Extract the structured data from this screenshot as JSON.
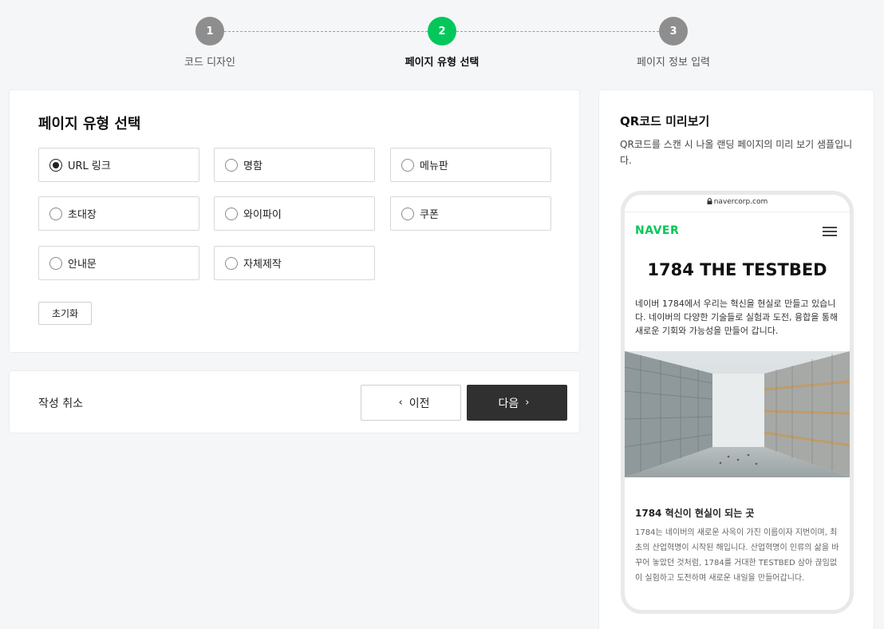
{
  "stepper": {
    "steps": [
      {
        "number": "1",
        "label": "코드 디자인"
      },
      {
        "number": "2",
        "label": "페이지 유형 선택"
      },
      {
        "number": "3",
        "label": "페이지 정보 입력"
      }
    ]
  },
  "type_card": {
    "title": "페이지 유형 선택",
    "options": [
      {
        "label": "URL 링크",
        "checked": true
      },
      {
        "label": "명함",
        "checked": false
      },
      {
        "label": "메뉴판",
        "checked": false
      },
      {
        "label": "초대장",
        "checked": false
      },
      {
        "label": "와이파이",
        "checked": false
      },
      {
        "label": "쿠폰",
        "checked": false
      },
      {
        "label": "안내문",
        "checked": false
      },
      {
        "label": "자체제작",
        "checked": false
      }
    ],
    "reset_label": "초기화"
  },
  "nav": {
    "cancel_label": "작성 취소",
    "prev_label": "이전",
    "next_label": "다음"
  },
  "preview": {
    "title": "QR코드 미리보기",
    "description": "QR코드를 스캔 시 나올 랜딩 페이지의 미리 보기 샘플입니다.",
    "phone": {
      "url": "navercorp.com",
      "logo": "NAVER",
      "headline": "1784 THE TESTBED",
      "intro": "네이버 1784에서 우리는 혁신을 현실로 만들고 있습니다. 네이버의 다양한 기술들로 실험과 도전, 융합을 통해 새로운 기회와 가능성을 만들어 갑니다.",
      "subheadline": "1784 혁신이 현실이 되는 곳",
      "body": "1784는 네이버의 새로운 사옥이 가진 이름이자 지번이며, 최초의 산업혁명이 시작된 해입니다. 산업혁명이 인류의 삶을 바꾸어 놓았던 것처럼, 1784를 거대한 TESTBED 삼아 끊임없이 실험하고 도전하며 새로운 내일을 만들어갑니다."
    }
  },
  "colors": {
    "accent": "#03c75a",
    "step_inactive": "#8e8e8e",
    "next_button": "#303030"
  },
  "icons": {
    "prev": "chevron-left-icon",
    "next": "chevron-right-icon",
    "lock": "lock-icon",
    "menu": "hamburger-menu-icon"
  }
}
